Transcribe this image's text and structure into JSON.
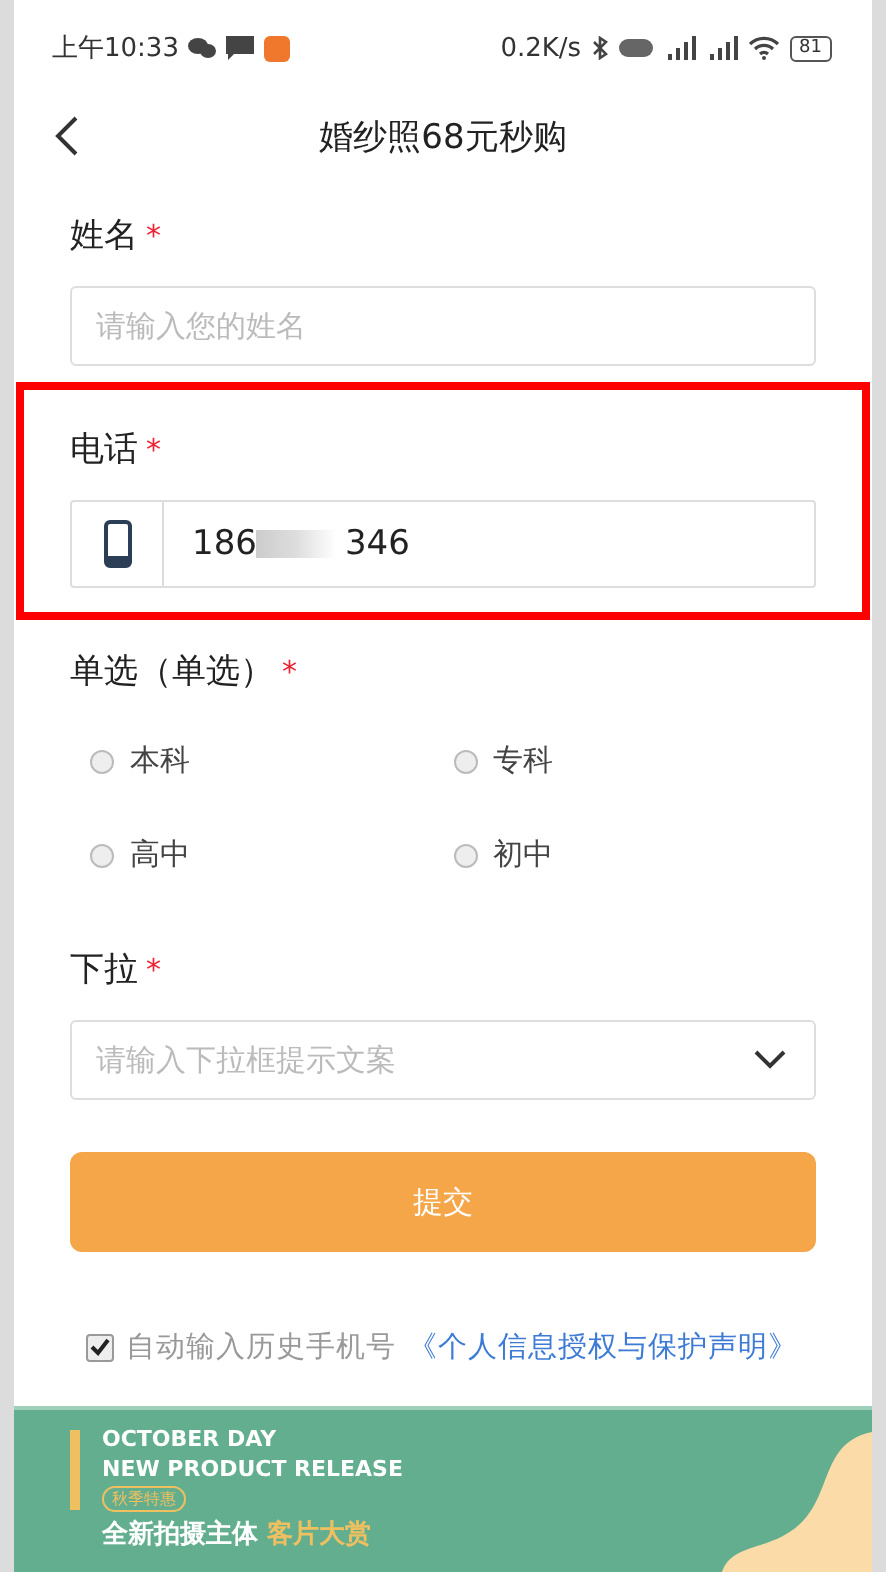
{
  "status_bar": {
    "time": "上午10:33",
    "network_speed": "0.2K/s",
    "battery": "81"
  },
  "header": {
    "title": "婚纱照68元秒购"
  },
  "fields": [
    {
      "kind": "text",
      "label": "姓名",
      "required_mark": "*",
      "placeholder": "请输入您的姓名",
      "highlighted": false
    },
    {
      "kind": "phone",
      "label": "电话",
      "required_mark": "*",
      "value_start": "186",
      "value_end": "346",
      "highlighted": true
    },
    {
      "kind": "radio",
      "label": "单选（单选）",
      "required_mark": "*",
      "highlighted": false,
      "options": [
        {
          "label": "本科",
          "selected": false
        },
        {
          "label": "专科",
          "selected": false
        },
        {
          "label": "高中",
          "selected": false
        },
        {
          "label": "初中",
          "selected": false
        }
      ]
    },
    {
      "kind": "select",
      "label": "下拉",
      "required_mark": "*",
      "placeholder": "请输入下拉框提示文案",
      "highlighted": false
    }
  ],
  "submit": {
    "label": "提交"
  },
  "consent": {
    "checked": true,
    "text": "自动输入历史手机号",
    "link": "《个人信息授权与保护声明》"
  },
  "banner": {
    "line_1": "OCTOBER DAY",
    "line_2": "NEW PRODUCT RELEASE",
    "badge": "秋季特惠",
    "headline": "全新拍摄主体",
    "headline_accent": "客片大赏"
  }
}
